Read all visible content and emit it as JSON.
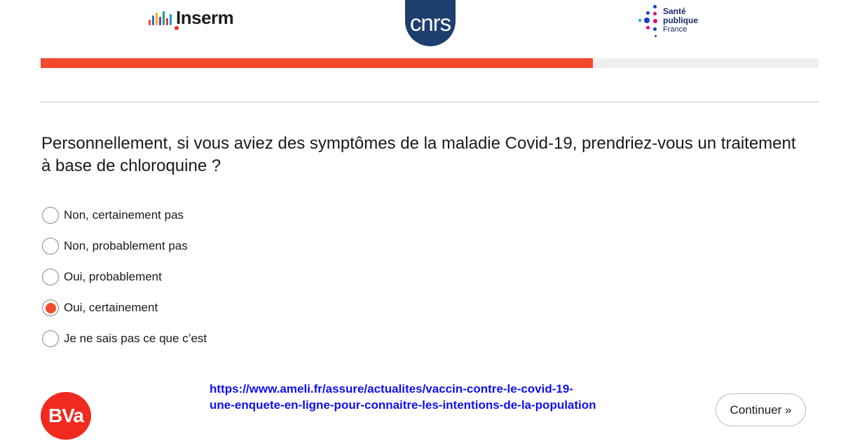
{
  "header": {
    "logos": {
      "inserm": {
        "text": "Inserm",
        "bar_colors": [
          "#f24a2d",
          "#2a6fd1",
          "#f5b400",
          "#7a3ab0",
          "#19a37d",
          "#e5352c",
          "#0aa0d9"
        ]
      },
      "cnrs": {
        "text": "cnrs",
        "color": "#1d3e6e"
      },
      "sante_publique": {
        "line1": "Santé",
        "line2": "publique",
        "line3": "France"
      }
    }
  },
  "progress": {
    "value": 0.71,
    "fill_color": "#f24a2d",
    "track_color": "#efefef"
  },
  "question": {
    "text": "Personnellement, si vous aviez des symptômes de la maladie Covid-19, prendriez-vous un traitement à base de chloroquine ?"
  },
  "options": [
    {
      "label": "Non, certainement pas",
      "selected": false
    },
    {
      "label": "Non, probablement pas",
      "selected": false
    },
    {
      "label": "Oui, probablement",
      "selected": false
    },
    {
      "label": "Oui, certainement",
      "selected": true
    },
    {
      "label": "Je ne sais pas ce que c’est",
      "selected": false
    }
  ],
  "footer": {
    "bva_logo": "BVa",
    "link_line1": "https://www.ameli.fr/assure/actualites/vaccin-contre-le-covid-19-",
    "link_line2": "une-enquete-en-ligne-pour-connaitre-les-intentions-de-la-population",
    "continue_label": "Continuer »"
  },
  "colors": {
    "accent": "#f24a2d",
    "link": "#1010ee"
  }
}
